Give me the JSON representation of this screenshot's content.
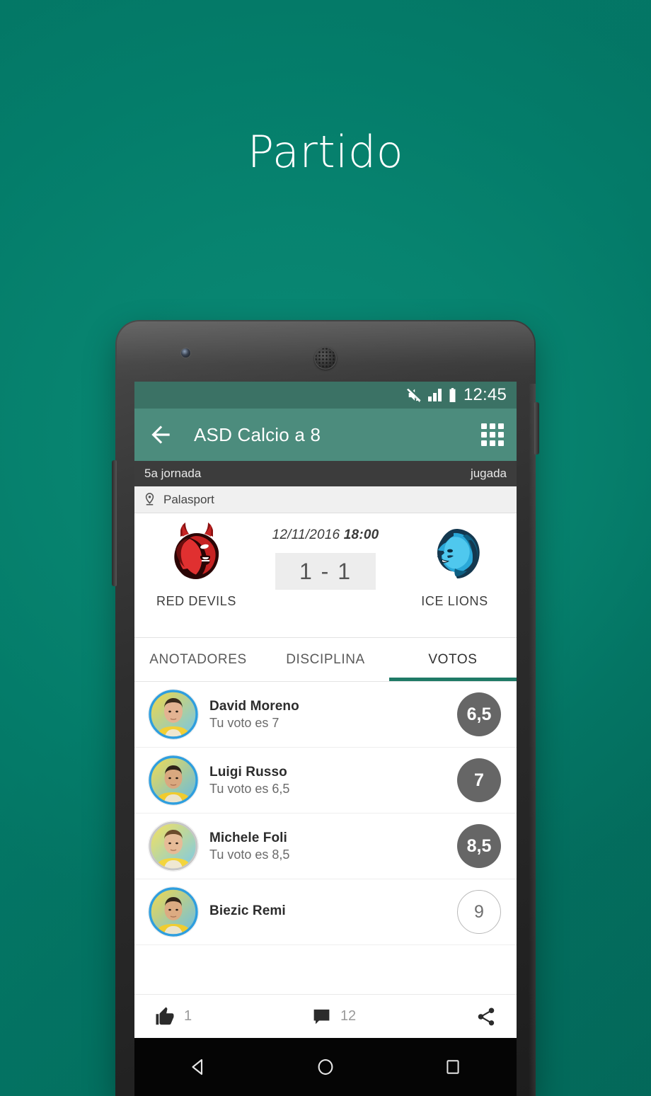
{
  "hero": {
    "title": "Partido"
  },
  "colors": {
    "background_teal": "#04806D",
    "status_bar": "#3B7265",
    "app_bar": "#4C8C7D",
    "tab_indicator": "#1F7A66",
    "jornada_bar": "#3C3C3C",
    "score_circle_filled": "#666666",
    "score_circle_empty_border": "#B9B9B9"
  },
  "status_bar": {
    "time": "12:45",
    "icons": [
      "mute-icon",
      "signal-icon",
      "battery-icon"
    ]
  },
  "app_bar": {
    "back_icon": "arrow-left-icon",
    "title": "ASD Calcio a 8",
    "menu_icon": "apps-grid-icon"
  },
  "matchday": {
    "label": "5a jornada",
    "status": "jugada"
  },
  "venue": {
    "icon": "location-pin-icon",
    "name": "Palasport"
  },
  "match": {
    "date": "12/11/2016",
    "time": "18:00",
    "score": "1 - 1",
    "home_team": {
      "name": "RED DEVILS",
      "crest": "red-devil-crest"
    },
    "away_team": {
      "name": "ICE LIONS",
      "crest": "ice-lion-crest"
    }
  },
  "tabs": [
    {
      "label": "ANOTADORES",
      "active": false
    },
    {
      "label": "DISCIPLINA",
      "active": false
    },
    {
      "label": "VOTOS",
      "active": true
    }
  ],
  "players": [
    {
      "name": "David Moreno",
      "vote_label": "Tu voto es 7",
      "score": "6,5",
      "score_style": "filled"
    },
    {
      "name": "Luigi Russo",
      "vote_label": "Tu voto es  6,5",
      "score": "7",
      "score_style": "filled"
    },
    {
      "name": "Michele Foli",
      "vote_label": "Tu voto es  8,5",
      "score": "8,5",
      "score_style": "filled"
    },
    {
      "name": "Biezic Remi",
      "vote_label": "",
      "score": "9",
      "score_style": "empty"
    }
  ],
  "action_bar": {
    "like_icon": "thumbs-up-icon",
    "like_count": "1",
    "comment_icon": "comment-icon",
    "comment_count": "12",
    "share_icon": "share-icon"
  },
  "nav_bar": {
    "back": "triangle-back-icon",
    "home": "circle-home-icon",
    "recents": "square-recents-icon"
  }
}
